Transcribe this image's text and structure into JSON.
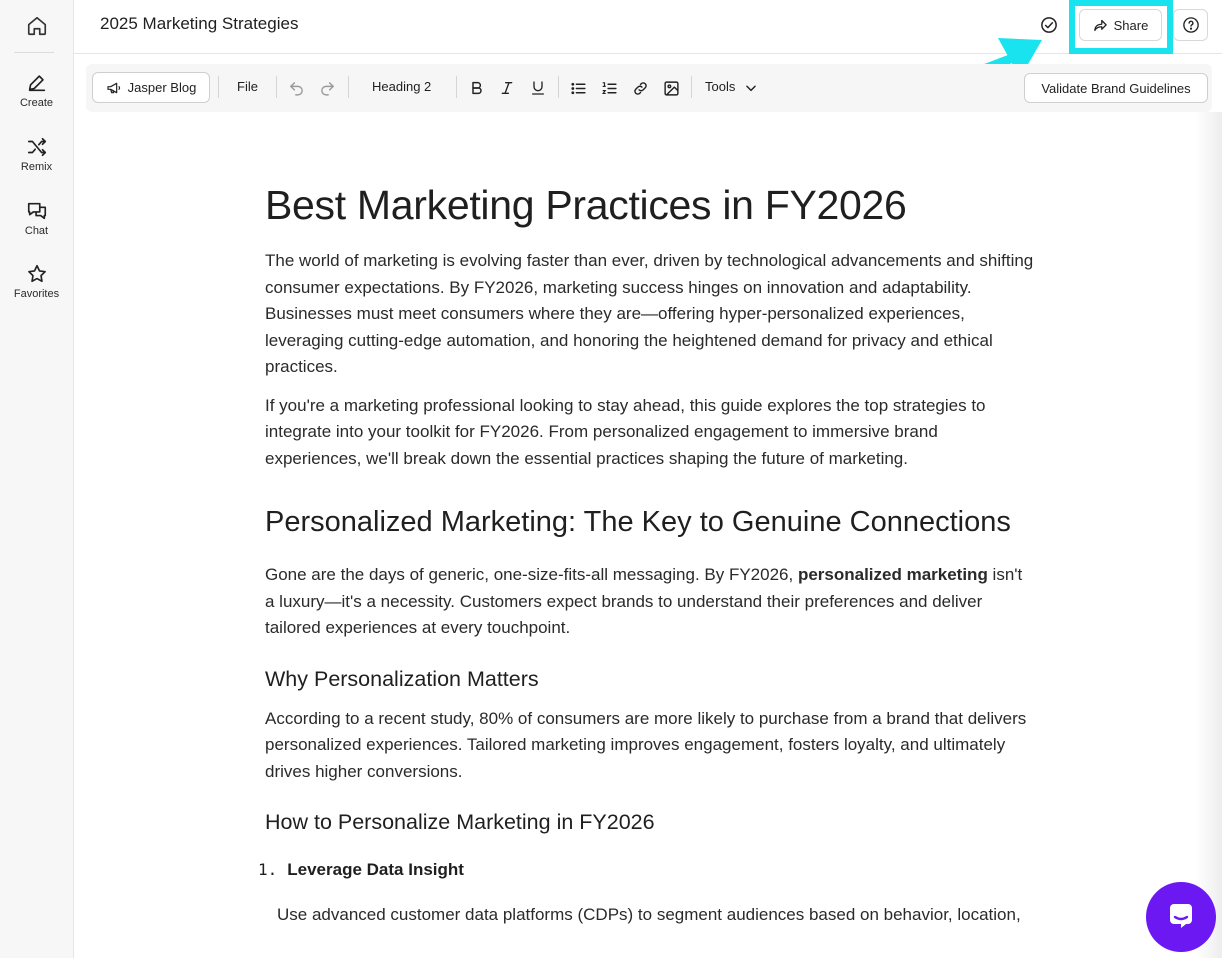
{
  "sidebar": {
    "items": [
      {
        "label": "Create",
        "icon": "pen-icon"
      },
      {
        "label": "Remix",
        "icon": "shuffle-icon"
      },
      {
        "label": "Chat",
        "icon": "chat-icon"
      },
      {
        "label": "Favorites",
        "icon": "star-icon"
      }
    ]
  },
  "header": {
    "title": "2025 Marketing Strategies",
    "share_label": "Share"
  },
  "toolbar": {
    "jasper_label": "Jasper Blog",
    "file_label": "File",
    "heading_label": "Heading 2",
    "tools_label": "Tools",
    "validate_label": "Validate Brand Guidelines"
  },
  "document": {
    "h1": "Best Marketing Practices in FY2026",
    "p1": "The world of marketing is evolving faster than ever, driven by technological advancements and shifting consumer expectations. By FY2026, marketing success hinges on innovation and adaptability. Businesses must meet consumers where they are—offering hyper-personalized experiences, leveraging cutting-edge automation, and honoring the heightened demand for privacy and ethical practices.",
    "p2": "If you're a marketing professional looking to stay ahead, this guide explores the top strategies to integrate into your toolkit for FY2026. From personalized engagement to immersive brand experiences, we'll break down the essential practices shaping the future of marketing.",
    "h2": "Personalized Marketing: The Key to Genuine Connections",
    "p3_a": "Gone are the days of generic, one-size-fits-all messaging. By FY2026, ",
    "p3_bold": "personalized marketing",
    "p3_b": " isn't a luxury—it's a necessity. Customers expect brands to understand their preferences and deliver tailored experiences at every touchpoint.",
    "h3_1": "Why Personalization Matters",
    "p4": "According to a recent study, 80% of consumers are more likely to purchase from a brand that delivers personalized experiences. Tailored marketing improves engagement, fosters loyalty, and ultimately drives higher conversions.",
    "h3_2": "How to Personalize Marketing in FY2026",
    "list_num": "1.",
    "list_title": "Leverage Data Insight",
    "p5": "Use advanced customer data platforms (CDPs) to segment audiences based on behavior, location,"
  },
  "colors": {
    "highlight": "#19e3ee",
    "chat_fab": "#6b18f2"
  }
}
